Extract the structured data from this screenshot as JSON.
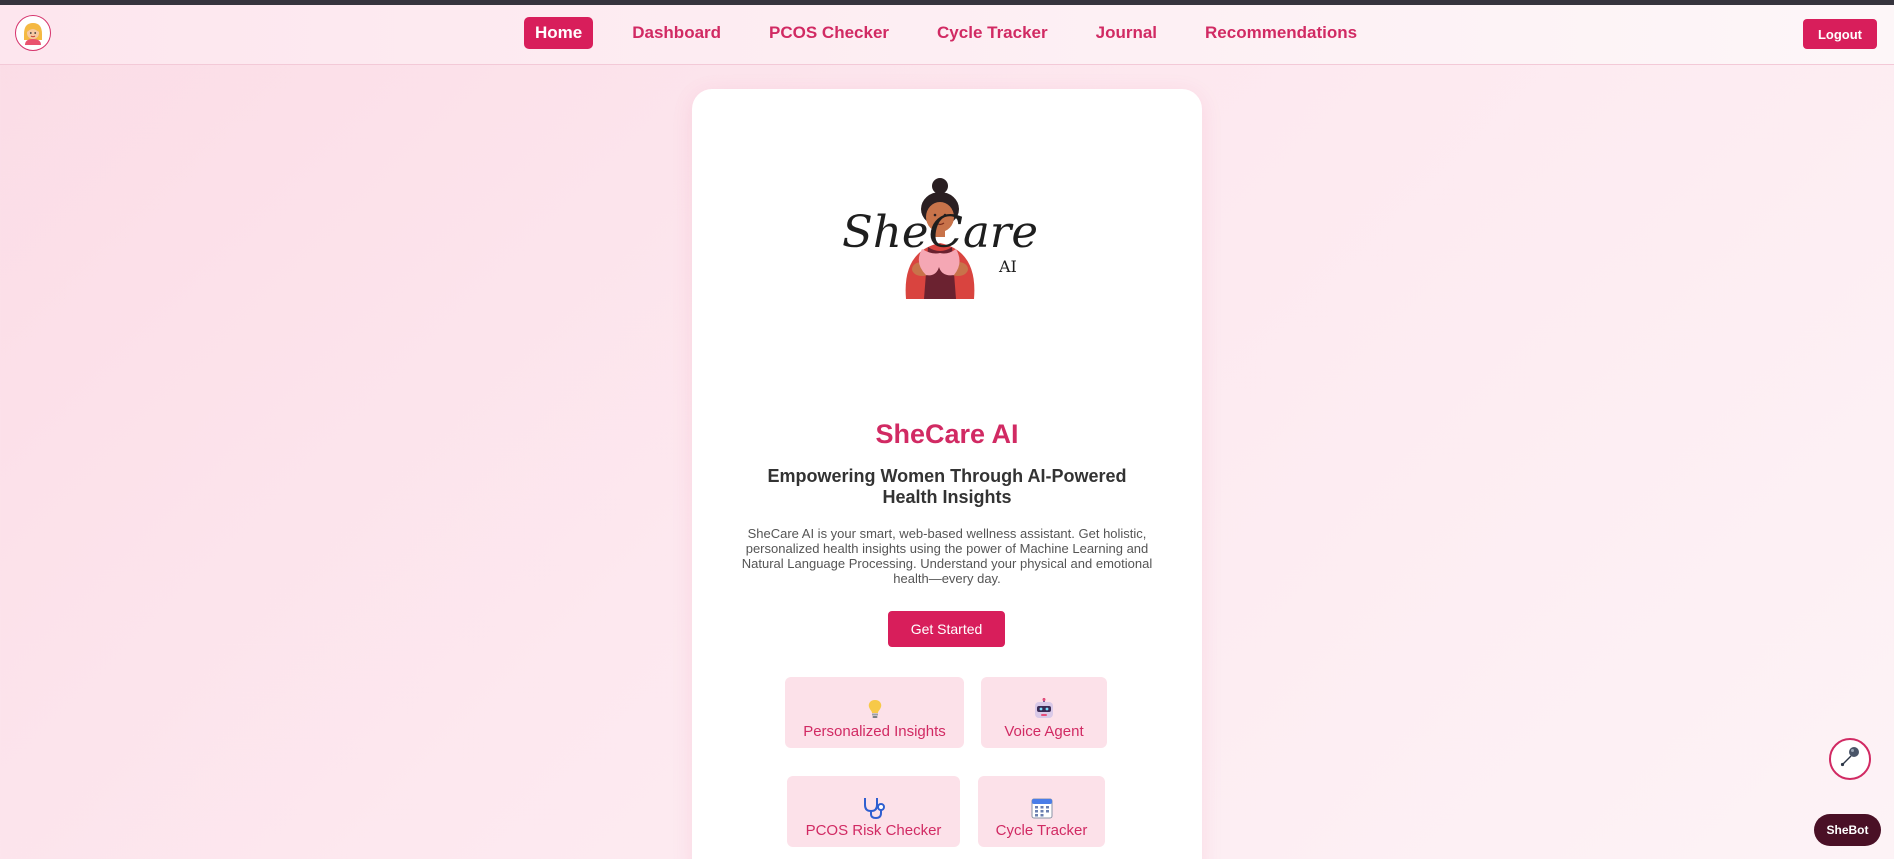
{
  "nav": {
    "links": [
      {
        "label": "Home"
      },
      {
        "label": "Dashboard"
      },
      {
        "label": "PCOS Checker"
      },
      {
        "label": "Cycle Tracker"
      },
      {
        "label": "Journal"
      },
      {
        "label": "Recommendations"
      }
    ],
    "active": "Home",
    "logout_label": "Logout",
    "avatar_icon": "woman-avatar-icon"
  },
  "hero": {
    "logo_text_main": "SheCare",
    "logo_text_sub": "AI",
    "title": "SheCare AI",
    "tagline": "Empowering Women Through AI-Powered Health Insights",
    "description": "SheCare AI is your smart, web-based wellness assistant. Get holistic, personalized health insights using the power of Machine Learning and Natural Language Processing. Understand your physical and emotional health—every day.",
    "cta_label": "Get Started"
  },
  "features": [
    {
      "label": "Personalized Insights",
      "icon": "lightbulb-icon"
    },
    {
      "label": "Voice Agent",
      "icon": "robot-icon"
    },
    {
      "label": "PCOS Risk Checker",
      "icon": "stethoscope-icon"
    },
    {
      "label": "Cycle Tracker",
      "icon": "calendar-icon"
    }
  ],
  "floating": {
    "mic_icon": "microphone-icon",
    "chatbot_label": "SheBot"
  },
  "colors": {
    "accent": "#d81e5b",
    "accent_text": "#d12a63",
    "feature_bg": "#fce1e9",
    "chatbot_bg": "#4a1026"
  }
}
